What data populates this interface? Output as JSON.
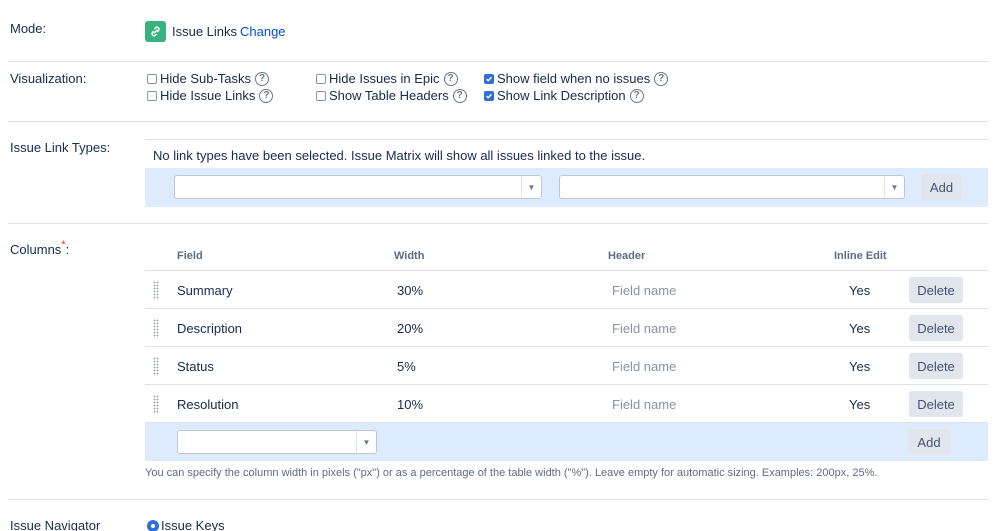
{
  "mode": {
    "label": "Mode:",
    "value": "Issue Links",
    "change_link": "Change",
    "icon": "link-icon"
  },
  "visualization": {
    "label": "Visualization:",
    "options": [
      {
        "label": "Hide Sub-Tasks",
        "checked": false
      },
      {
        "label": "Hide Issue Links",
        "checked": false
      },
      {
        "label": "Hide Issues in Epic",
        "checked": false
      },
      {
        "label": "Show Table Headers",
        "checked": false
      },
      {
        "label": "Show field when no issues",
        "checked": true
      },
      {
        "label": "Show Link Description",
        "checked": true
      }
    ]
  },
  "link_types": {
    "label": "Issue Link Types:",
    "message": "No link types have been selected. Issue Matrix will show all issues linked to the issue.",
    "add_label": "Add"
  },
  "columns": {
    "label": "Columns",
    "required_mark": "*",
    "label_suffix": ":",
    "headers": {
      "field": "Field",
      "width": "Width",
      "header": "Header",
      "inline_edit": "Inline Edit"
    },
    "rows": [
      {
        "field": "Summary",
        "width": "30%",
        "header_placeholder": "Field name",
        "inline_edit": "Yes",
        "delete_label": "Delete"
      },
      {
        "field": "Description",
        "width": "20%",
        "header_placeholder": "Field name",
        "inline_edit": "Yes",
        "delete_label": "Delete"
      },
      {
        "field": "Status",
        "width": "5%",
        "header_placeholder": "Field name",
        "inline_edit": "Yes",
        "delete_label": "Delete"
      },
      {
        "field": "Resolution",
        "width": "10%",
        "header_placeholder": "Field name",
        "inline_edit": "Yes",
        "delete_label": "Delete"
      }
    ],
    "add_label": "Add",
    "hint": "You can specify the column width in pixels (\"px\") or as a percentage of the table width (\"%\"). Leave empty for automatic sizing. Examples: 200px, 25%."
  },
  "navigator": {
    "label": "Issue Navigator",
    "option": "Issue Keys"
  }
}
